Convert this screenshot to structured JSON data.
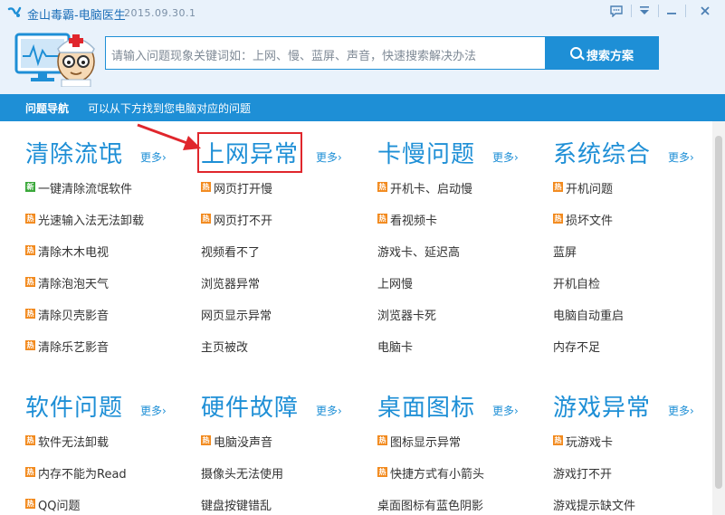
{
  "window": {
    "title": "金山毒霸-电脑医生",
    "version": "2015.09.30.1"
  },
  "search": {
    "placeholder": "请输入问题现象关键词如：上网、慢、蓝屏、声音，快速搜索解决办法",
    "button_label": "搜索方案"
  },
  "nav": {
    "title": "问题导航",
    "description": "可以从下方找到您电脑对应的问题"
  },
  "more_label": "更多›",
  "categories": [
    {
      "title": "清除流氓",
      "items": [
        {
          "label": "一键清除流氓软件",
          "badge": "新"
        },
        {
          "label": "光速输入法无法卸载",
          "badge": "热"
        },
        {
          "label": "清除木木电视",
          "badge": "热"
        },
        {
          "label": "清除泡泡天气",
          "badge": "热"
        },
        {
          "label": "清除贝壳影音",
          "badge": "热"
        },
        {
          "label": "清除乐艺影音",
          "badge": "热"
        }
      ]
    },
    {
      "title": "上网异常",
      "items": [
        {
          "label": "网页打开慢",
          "badge": "热"
        },
        {
          "label": "网页打不开",
          "badge": "热"
        },
        {
          "label": "视频看不了",
          "badge": ""
        },
        {
          "label": "浏览器异常",
          "badge": ""
        },
        {
          "label": "网页显示异常",
          "badge": ""
        },
        {
          "label": "主页被改",
          "badge": ""
        }
      ]
    },
    {
      "title": "卡慢问题",
      "items": [
        {
          "label": "开机卡、启动慢",
          "badge": "热"
        },
        {
          "label": "看视频卡",
          "badge": "热"
        },
        {
          "label": "游戏卡、延迟高",
          "badge": ""
        },
        {
          "label": "上网慢",
          "badge": ""
        },
        {
          "label": "浏览器卡死",
          "badge": ""
        },
        {
          "label": "电脑卡",
          "badge": ""
        }
      ]
    },
    {
      "title": "系统综合",
      "items": [
        {
          "label": "开机问题",
          "badge": "热"
        },
        {
          "label": "损坏文件",
          "badge": "热"
        },
        {
          "label": "蓝屏",
          "badge": ""
        },
        {
          "label": "开机自检",
          "badge": ""
        },
        {
          "label": "电脑自动重启",
          "badge": ""
        },
        {
          "label": "内存不足",
          "badge": ""
        }
      ]
    },
    {
      "title": "软件问题",
      "items": [
        {
          "label": "软件无法卸载",
          "badge": "热"
        },
        {
          "label": "内存不能为Read",
          "badge": "热"
        },
        {
          "label": "QQ问题",
          "badge": "热"
        }
      ]
    },
    {
      "title": "硬件故障",
      "items": [
        {
          "label": "电脑没声音",
          "badge": "热"
        },
        {
          "label": "摄像头无法使用",
          "badge": ""
        },
        {
          "label": "键盘按键错乱",
          "badge": ""
        }
      ]
    },
    {
      "title": "桌面图标",
      "items": [
        {
          "label": "图标显示异常",
          "badge": "热"
        },
        {
          "label": "快捷方式有小箭头",
          "badge": "热"
        },
        {
          "label": "桌面图标有蓝色阴影",
          "badge": ""
        }
      ]
    },
    {
      "title": "游戏异常",
      "items": [
        {
          "label": "玩游戏卡",
          "badge": "热"
        },
        {
          "label": "游戏打不开",
          "badge": ""
        },
        {
          "label": "游戏提示缺文件",
          "badge": ""
        }
      ]
    }
  ]
}
